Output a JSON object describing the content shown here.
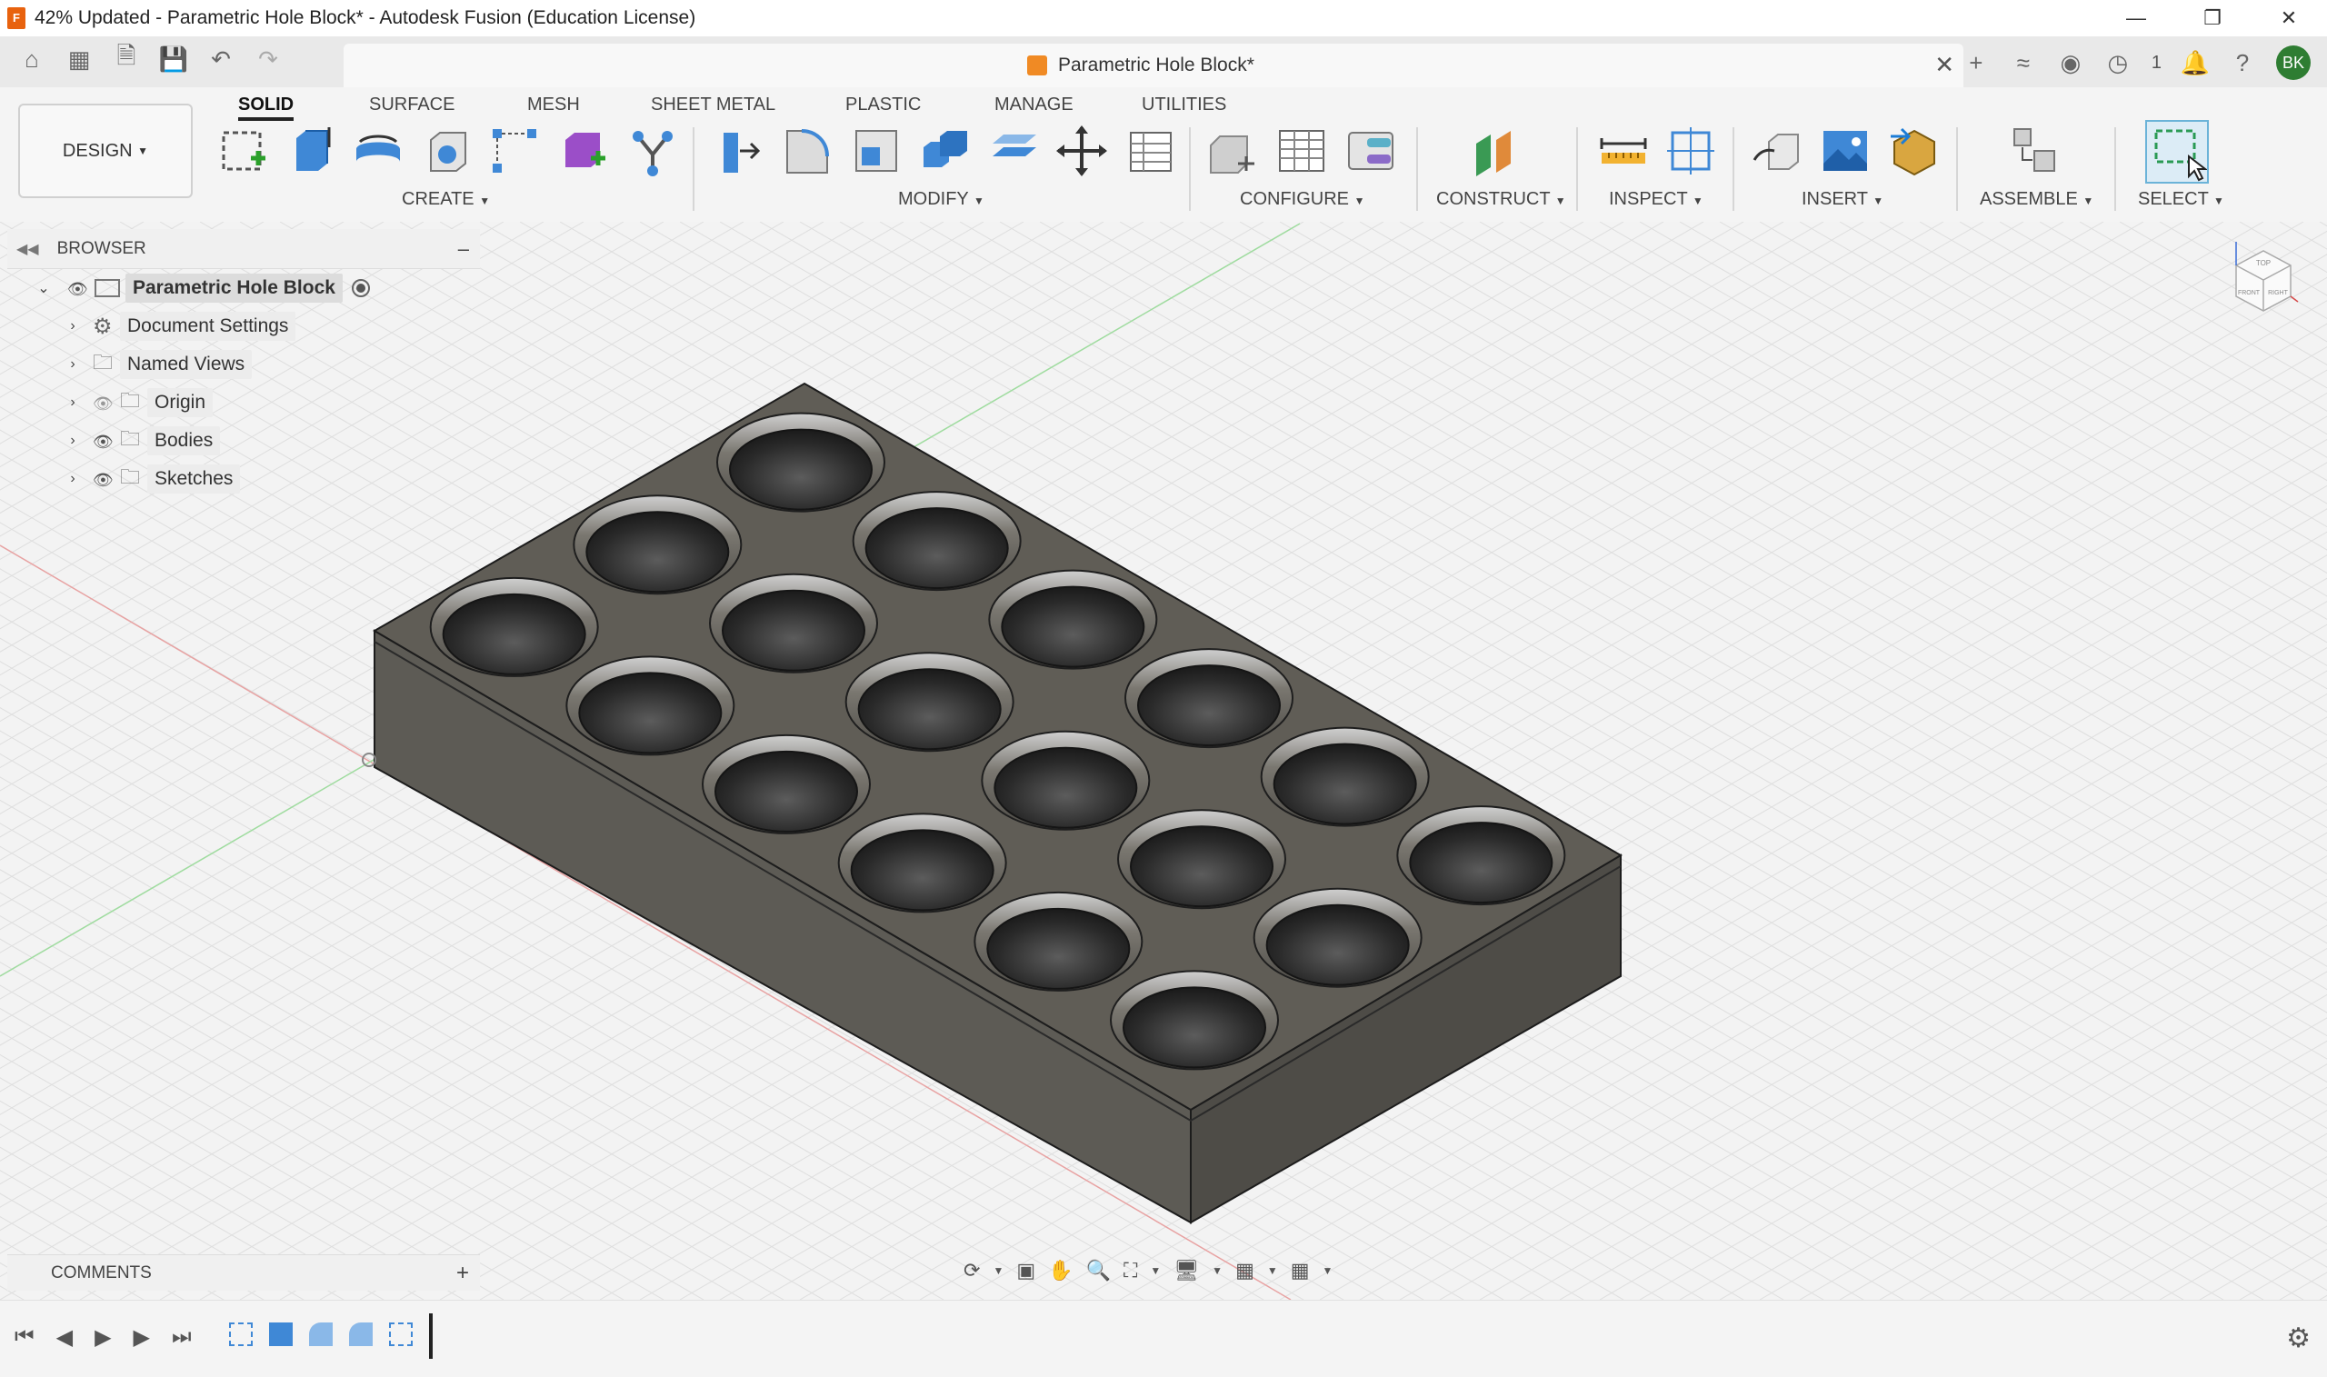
{
  "window": {
    "title": "42% Updated - Parametric Hole Block* - Autodesk Fusion (Education License)",
    "app_icon_letter": "F",
    "controls": [
      "minimize-icon",
      "restore-icon",
      "close-icon"
    ]
  },
  "tabbar": {
    "left_icons": [
      "home-icon",
      "grid-icon",
      "file-icon",
      "save-icon",
      "undo-icon",
      "redo-icon"
    ],
    "document_tab": "Parametric Hole Block*",
    "right_icons": [
      "plus-icon",
      "extensions-icon",
      "online-icon",
      "job-status-icon",
      "notifications-icon",
      "help-icon"
    ],
    "job_count": "1",
    "avatar_initials": "BK"
  },
  "ribbon": {
    "workspace": "DESIGN",
    "tabs": [
      "SOLID",
      "SURFACE",
      "MESH",
      "SHEET METAL",
      "PLASTIC",
      "MANAGE",
      "UTILITIES"
    ],
    "active_tab": "SOLID",
    "groups": [
      "CREATE",
      "MODIFY",
      "CONFIGURE",
      "CONSTRUCT",
      "INSPECT",
      "INSERT",
      "ASSEMBLE",
      "SELECT"
    ]
  },
  "browser": {
    "header": "BROWSER",
    "root": "Parametric Hole Block",
    "items": [
      "Document Settings",
      "Named Views",
      "Origin",
      "Bodies",
      "Sketches"
    ]
  },
  "comments": {
    "label": "COMMENTS"
  },
  "viewcube": {
    "labels": [
      "TOP",
      "FRONT",
      "RIGHT"
    ]
  },
  "colors": {
    "accent": "#0696d7",
    "model_body": "#5f5c55",
    "avatar": "#2e7d32",
    "brand_orange": "#e8620e"
  }
}
